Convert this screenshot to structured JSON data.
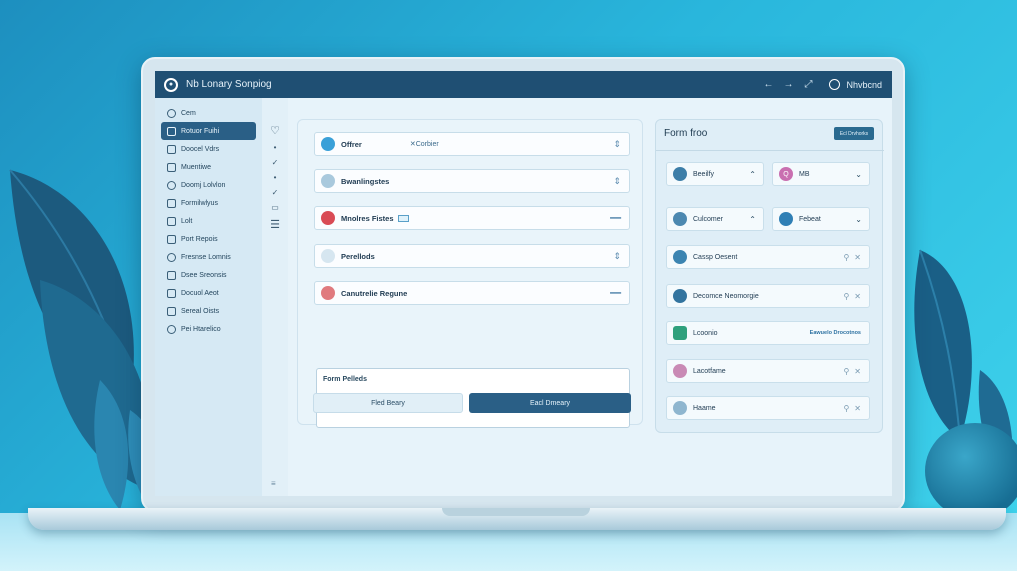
{
  "window": {
    "title": "Nb Lonary Sonpiog",
    "user": "Nhvbcnd"
  },
  "sidebar": {
    "items": [
      {
        "label": "Cem",
        "icon": "home-icon",
        "active": false
      },
      {
        "label": "Rotuor Fuihi",
        "icon": "file-icon",
        "active": true
      },
      {
        "label": "Doocel Vdrs",
        "icon": "folder-icon",
        "active": false
      },
      {
        "label": "Muentiwe",
        "icon": "list-icon",
        "active": false
      },
      {
        "label": "Doomj Lolvlon",
        "icon": "doc-icon",
        "active": false
      },
      {
        "label": "Formilwlyus",
        "icon": "form-icon",
        "active": false
      },
      {
        "label": "Lolt",
        "icon": "box-icon",
        "active": false
      },
      {
        "label": "Port Repois",
        "icon": "report-icon",
        "active": false
      },
      {
        "label": "Fresnse Lomnis",
        "icon": "doc-icon",
        "active": false
      },
      {
        "label": "Dsee Sreonsis",
        "icon": "table-icon",
        "active": false
      },
      {
        "label": "Docuol Aeot",
        "icon": "user-icon",
        "active": false
      },
      {
        "label": "Sereal Oists",
        "icon": "gear-icon",
        "active": false
      },
      {
        "label": "Pei Htarelico",
        "icon": "info-icon",
        "active": false
      }
    ],
    "footer": "≡"
  },
  "main": {
    "rows": [
      {
        "label": "Offrer",
        "mid": "Corbier",
        "avatar_color": "#3aa0d8",
        "right": "⇕"
      },
      {
        "label": "Bwanlingstes",
        "mid": "",
        "avatar_color": "#a9c9dd",
        "right": "⇕"
      },
      {
        "label": "Mnolres Fistes",
        "mid": "",
        "avatar_color": "#d94b55",
        "right": "━━"
      },
      {
        "label": "Perellods",
        "mid": "",
        "avatar_color": "#d6e6f0",
        "right": "⇕"
      },
      {
        "label": "Canutrelie Regune",
        "mid": "",
        "avatar_color": "#e07a7e",
        "right": "━━"
      }
    ],
    "textarea_label": "Form Pelleds",
    "secondary_button": "Fled Beary",
    "primary_button": "Eacl Dmeary"
  },
  "form_panel": {
    "title": "Form froo",
    "button": "Ecl Drvhorks",
    "cards": [
      {
        "label": "Beeilfy",
        "avatar_color": "#3d7ea8"
      },
      {
        "label": "MB",
        "avatar_color": "#c96fb0",
        "badge": "Q"
      },
      {
        "label": "Culcomer",
        "avatar_color": "#4c88b0"
      },
      {
        "label": "Febeat",
        "avatar_color": "#2f7fb5"
      },
      {
        "label": "Cassp Oesent",
        "avatar_color": "#3b84b1"
      },
      {
        "label": "Decomce Neomorgie",
        "avatar_color": "#33749f"
      },
      {
        "label": "Lcoonio",
        "avatar_color": "#2fa07c",
        "link": "Eawuelo Drocotnos"
      },
      {
        "label": "Lacotfame",
        "avatar_color": "#c98ab5"
      },
      {
        "label": "Haame",
        "avatar_color": "#8fb6cf"
      }
    ]
  }
}
